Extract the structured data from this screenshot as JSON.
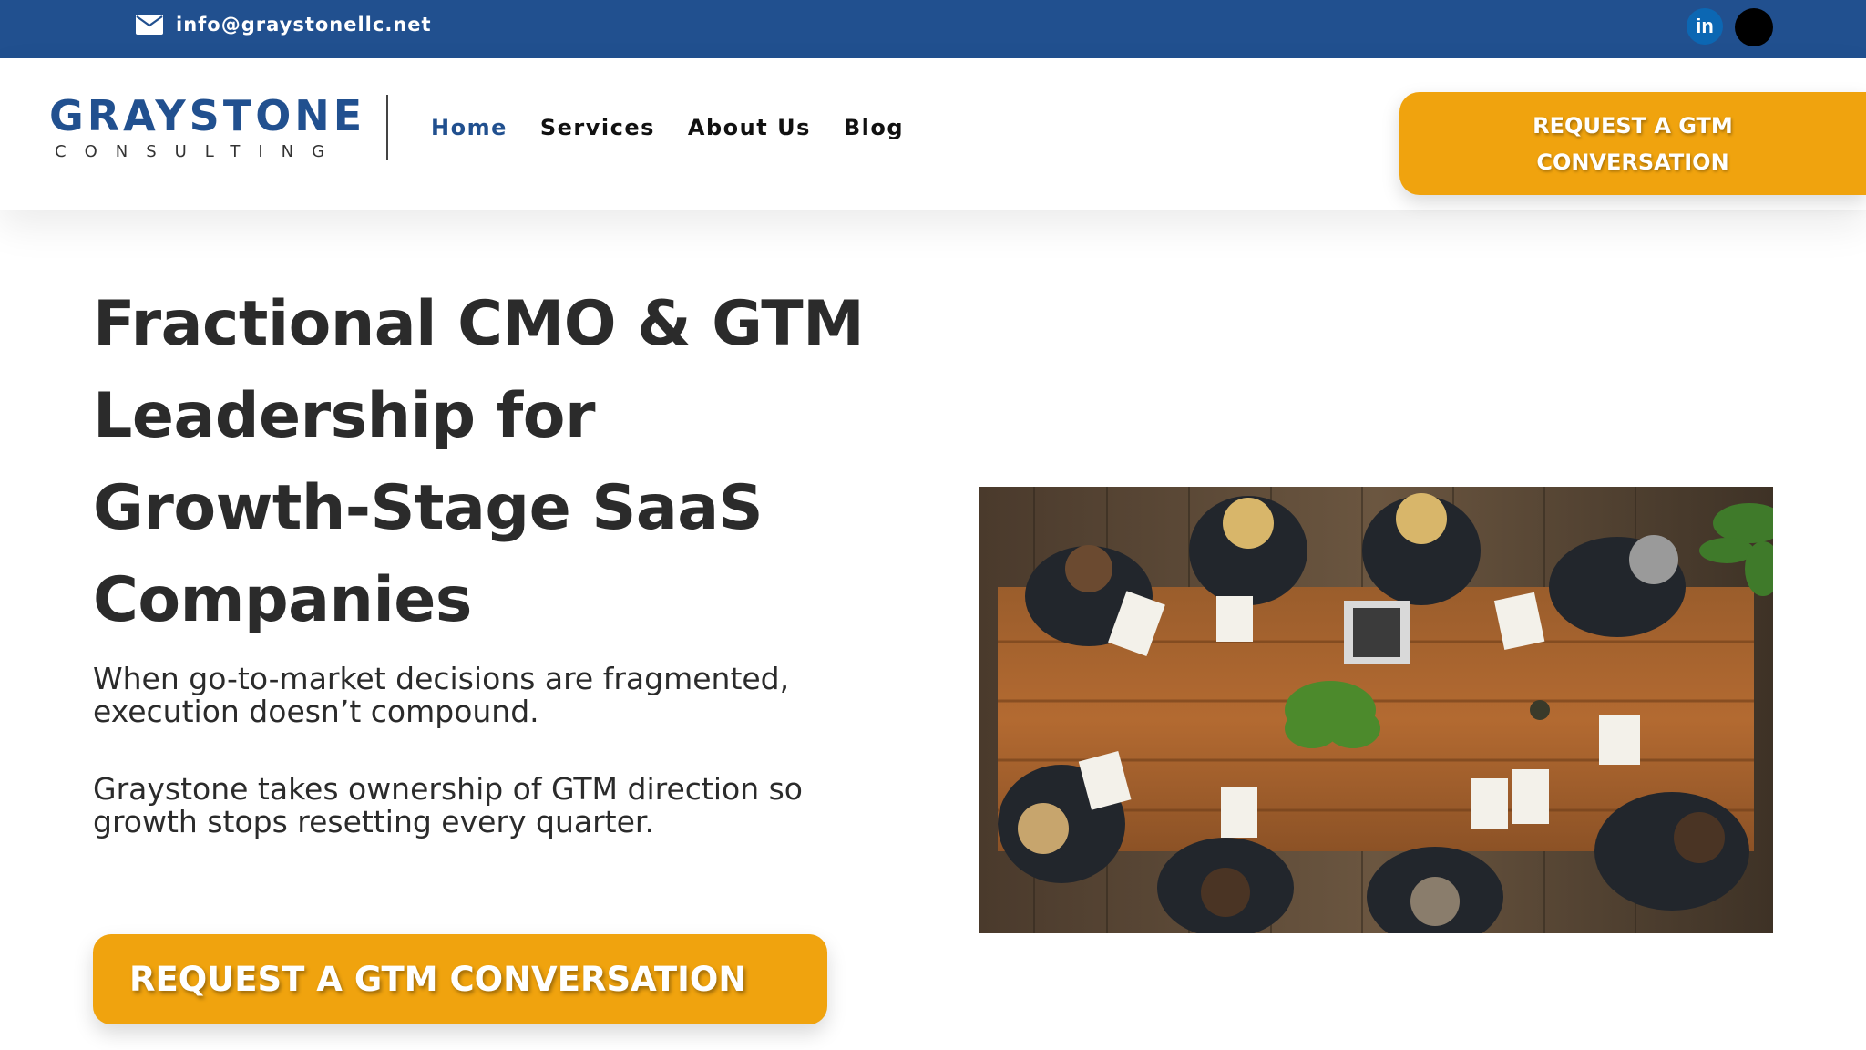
{
  "topbar": {
    "email": "info@graystonellc.net",
    "social": [
      {
        "label": "in",
        "icon": "linkedin-icon"
      },
      {
        "label": "",
        "icon": "social-circle-icon"
      }
    ]
  },
  "header": {
    "logo": {
      "main": "GRAYSTONE",
      "sub": "CONSULTING"
    },
    "nav": [
      {
        "label": "Home",
        "active": true
      },
      {
        "label": "Services",
        "active": false
      },
      {
        "label": "About Us",
        "active": false
      },
      {
        "label": "Blog",
        "active": false
      }
    ],
    "cta_line1": "REQUEST A GTM",
    "cta_line2": "CONVERSATION"
  },
  "hero": {
    "title_lines": [
      "Fractional CMO & GTM",
      "Leadership for",
      "Growth-Stage SaaS",
      "Companies"
    ],
    "paragraph1": "When go-to-market decisions are fragmented, execution doesn’t compound.",
    "paragraph2": "Graystone takes ownership of GTM direction so growth stops resetting every quarter.",
    "cta": "REQUEST A GTM CONVERSATION"
  },
  "colors": {
    "brand_blue": "#21508f",
    "accent_orange": "#f0a30e",
    "text_dark": "#2b2b2b"
  }
}
